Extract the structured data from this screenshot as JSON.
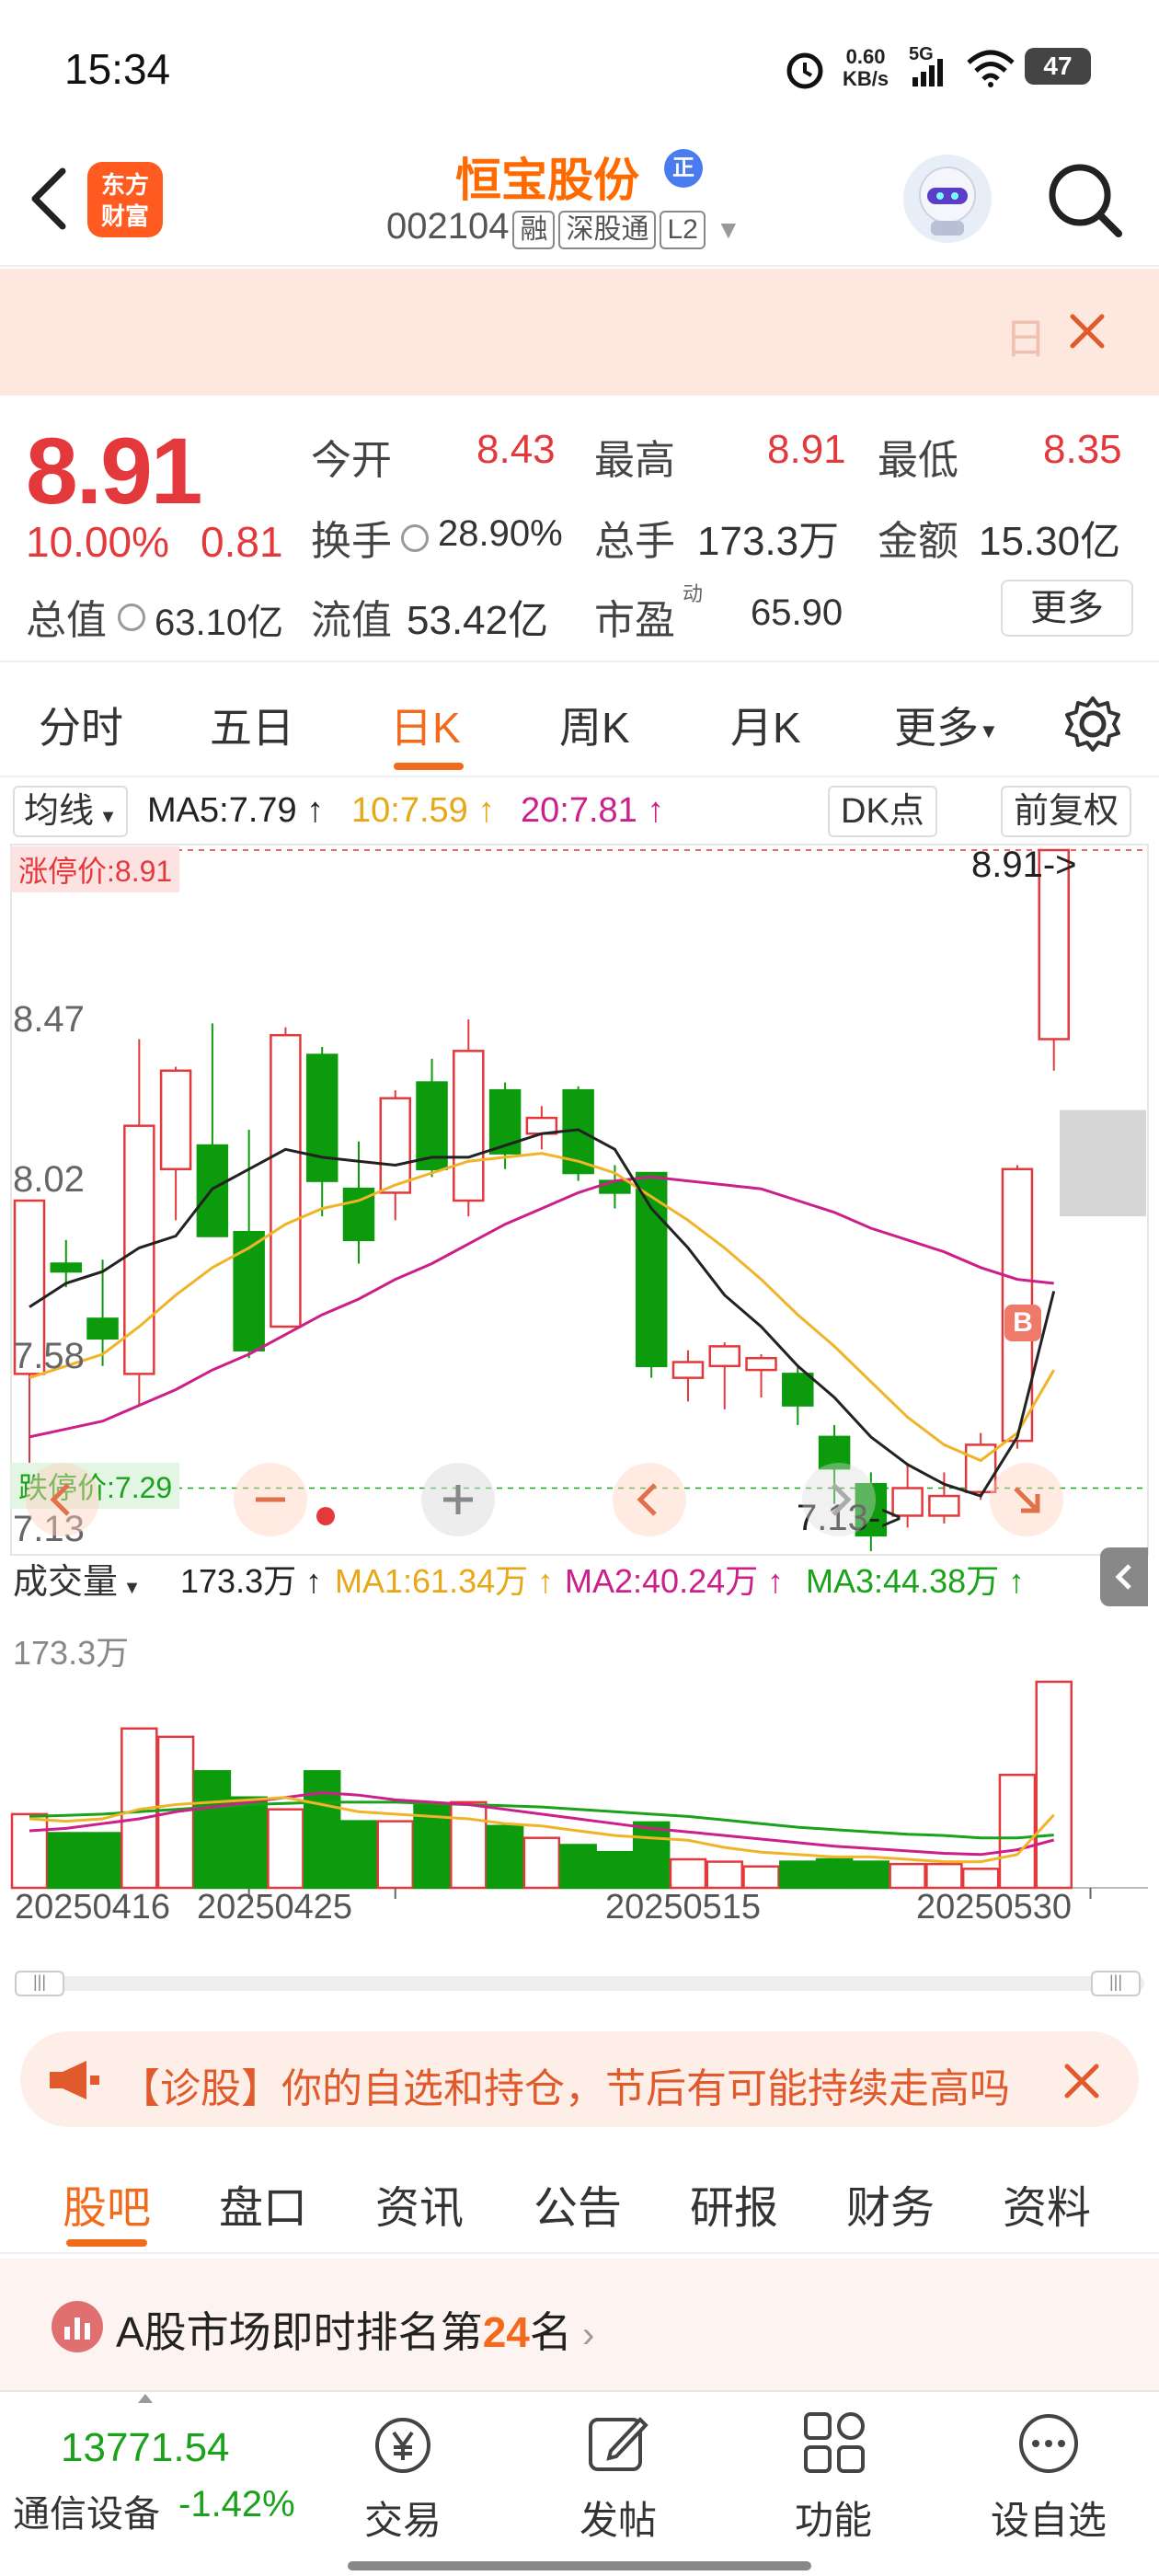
{
  "status_bar": {
    "time": "15:34",
    "net_speed_value": "0.60",
    "net_speed_unit": "KB/s",
    "signal": "5G",
    "battery": "47"
  },
  "nav": {
    "logo_line1": "东方",
    "logo_line2": "财富",
    "stock_name": "恒宝股份",
    "badge": "正",
    "stock_code": "002104",
    "tag_margin": "融",
    "tag_connect": "深股通",
    "tag_level": "L2"
  },
  "banner": {
    "text": "日"
  },
  "quote": {
    "price": "8.91",
    "change_pct": "10.00%",
    "change": "0.81",
    "open_label": "今开",
    "open": "8.43",
    "high_label": "最高",
    "high": "8.91",
    "low_label": "最低",
    "low": "8.35",
    "turnover_label": "换手",
    "turnover": "28.90%",
    "volume_label": "总手",
    "volume": "173.3万",
    "amount_label": "金额",
    "amount": "15.30亿",
    "mktcap_label": "总值",
    "mktcap": "63.10亿",
    "float_label": "流值",
    "float": "53.42亿",
    "pe_label": "市盈",
    "pe_sup": "动",
    "pe": "65.90",
    "more_button": "更多"
  },
  "period_tabs": [
    "分时",
    "五日",
    "日K",
    "周K",
    "月K",
    "更多"
  ],
  "period_tabs_active": 2,
  "chart_toolbar": {
    "indicator_select": "均线",
    "ma5": "MA5:7.79 ↑",
    "ma10": "10:7.59 ↑",
    "ma20": "20:7.81 ↑",
    "dk_button": "DK点",
    "fq_button": "前复权"
  },
  "kline_labels": {
    "limit_up": "涨停价:8.91",
    "limit_down": "跌停价:7.29",
    "y_top": "8.91",
    "y_847": "8.47",
    "y_802": "8.02",
    "y_758": "7.58",
    "y_713": "7.13",
    "max_marker": "8.91->",
    "min_marker": "7.13->",
    "buy_marker": "B"
  },
  "volume_toolbar": {
    "select": "成交量",
    "value": "173.3万 ↑",
    "ma1": "MA1:61.34万 ↑",
    "ma2": "MA2:40.24万 ↑",
    "ma3": "MA3:44.38万 ↑",
    "y_top": "173.3万"
  },
  "x_dates": [
    "20250416",
    "20250425",
    "20250515",
    "20250530"
  ],
  "chart_data": {
    "type": "candlestick",
    "dates_shown": [
      "20250416",
      "20250425",
      "20250515",
      "20250530"
    ],
    "y_ticks": [
      8.91,
      8.47,
      8.02,
      7.58,
      7.13
    ],
    "ylim": [
      7.13,
      8.91
    ],
    "candles": [
      {
        "o": 7.58,
        "c": 8.02,
        "h": 8.02,
        "l": 7.33
      },
      {
        "o": 7.86,
        "c": 7.84,
        "h": 7.92,
        "l": 7.8
      },
      {
        "o": 7.72,
        "c": 7.67,
        "h": 7.87,
        "l": 7.6
      },
      {
        "o": 7.58,
        "c": 8.21,
        "h": 8.43,
        "l": 7.5
      },
      {
        "o": 8.1,
        "c": 8.35,
        "h": 8.36,
        "l": 7.97
      },
      {
        "o": 8.16,
        "c": 7.93,
        "h": 8.47,
        "l": 7.93
      },
      {
        "o": 7.94,
        "c": 7.64,
        "h": 8.2,
        "l": 7.62
      },
      {
        "o": 7.7,
        "c": 8.44,
        "h": 8.46,
        "l": 7.7
      },
      {
        "o": 8.39,
        "c": 8.07,
        "h": 8.41,
        "l": 7.98
      },
      {
        "o": 8.05,
        "c": 7.92,
        "h": 8.17,
        "l": 7.86
      },
      {
        "o": 8.04,
        "c": 8.28,
        "h": 8.3,
        "l": 7.97
      },
      {
        "o": 8.32,
        "c": 8.1,
        "h": 8.38,
        "l": 8.08
      },
      {
        "o": 8.02,
        "c": 8.4,
        "h": 8.48,
        "l": 7.98
      },
      {
        "o": 8.3,
        "c": 8.14,
        "h": 8.32,
        "l": 8.1
      },
      {
        "o": 8.19,
        "c": 8.23,
        "h": 8.26,
        "l": 8.15
      },
      {
        "o": 8.3,
        "c": 8.09,
        "h": 8.31,
        "l": 8.07
      },
      {
        "o": 8.07,
        "c": 8.04,
        "h": 8.11,
        "l": 8.0
      },
      {
        "o": 8.09,
        "c": 7.6,
        "h": 8.09,
        "l": 7.57
      },
      {
        "o": 7.57,
        "c": 7.61,
        "h": 7.64,
        "l": 7.51
      },
      {
        "o": 7.6,
        "c": 7.65,
        "h": 7.66,
        "l": 7.49
      },
      {
        "o": 7.59,
        "c": 7.62,
        "h": 7.63,
        "l": 7.52
      },
      {
        "o": 7.58,
        "c": 7.5,
        "h": 7.6,
        "l": 7.45
      },
      {
        "o": 7.42,
        "c": 7.34,
        "h": 7.45,
        "l": 7.25
      },
      {
        "o": 7.3,
        "c": 7.17,
        "h": 7.33,
        "l": 7.13
      },
      {
        "o": 7.22,
        "c": 7.29,
        "h": 7.35,
        "l": 7.19
      },
      {
        "o": 7.22,
        "c": 7.27,
        "h": 7.33,
        "l": 7.2
      },
      {
        "o": 7.28,
        "c": 7.4,
        "h": 7.43,
        "l": 7.26
      },
      {
        "o": 7.41,
        "c": 8.1,
        "h": 8.11,
        "l": 7.39
      },
      {
        "o": 8.43,
        "c": 8.91,
        "h": 8.91,
        "l": 8.35
      }
    ],
    "ma5": [
      7.75,
      7.81,
      7.84,
      7.9,
      7.93,
      8.05,
      8.1,
      8.15,
      8.13,
      8.12,
      8.11,
      8.13,
      8.13,
      8.16,
      8.19,
      8.2,
      8.15,
      8.0,
      7.9,
      7.78,
      7.7,
      7.6,
      7.52,
      7.42,
      7.35,
      7.3,
      7.27,
      7.42,
      7.79
    ],
    "ma10": [
      7.57,
      7.6,
      7.63,
      7.7,
      7.78,
      7.85,
      7.9,
      7.96,
      8.0,
      8.02,
      8.06,
      8.09,
      8.12,
      8.13,
      8.14,
      8.12,
      8.09,
      8.03,
      7.97,
      7.9,
      7.82,
      7.73,
      7.65,
      7.56,
      7.47,
      7.4,
      7.36,
      7.43,
      7.59
    ],
    "ma20": [
      7.42,
      7.44,
      7.46,
      7.5,
      7.54,
      7.59,
      7.63,
      7.68,
      7.73,
      7.77,
      7.82,
      7.86,
      7.91,
      7.96,
      8.0,
      8.04,
      8.07,
      8.08,
      8.07,
      8.06,
      8.05,
      8.02,
      7.99,
      7.95,
      7.92,
      7.89,
      7.85,
      7.82,
      7.81
    ],
    "volume_max": 173.3,
    "volume_unit": "万",
    "volume": [
      62,
      46,
      46,
      134,
      127,
      98,
      76,
      66,
      98,
      56,
      56,
      70,
      72,
      52,
      42,
      36,
      30,
      55,
      24,
      22,
      18,
      22,
      24,
      22,
      20,
      20,
      16,
      95,
      173.3
    ],
    "vol_ma1": [
      58,
      56,
      58,
      66,
      70,
      72,
      74,
      76,
      70,
      64,
      62,
      60,
      58,
      54,
      52,
      48,
      44,
      42,
      40,
      34,
      30,
      28,
      26,
      26,
      24,
      22,
      22,
      28,
      61.34
    ],
    "vol_ma2": [
      48,
      50,
      54,
      58,
      64,
      68,
      72,
      76,
      80,
      78,
      74,
      72,
      70,
      66,
      62,
      58,
      54,
      50,
      47,
      44,
      41,
      38,
      35,
      33,
      31,
      29,
      28,
      32,
      40.24
    ],
    "vol_ma3": [
      60,
      61,
      62,
      64,
      66,
      68,
      70,
      71,
      72,
      72,
      72,
      71,
      70,
      69,
      68,
      66,
      64,
      62,
      60,
      57,
      54,
      51,
      49,
      47,
      45,
      44,
      42,
      42,
      44.38
    ],
    "colors": {
      "up": "#e4393c",
      "down": "#0c9b0c",
      "ma5": "#222222",
      "ma10": "#f0b429",
      "ma20": "#cc1f8a"
    }
  },
  "notice": {
    "text": "【诊股】你的自选和持仓，节后有可能持续走高吗"
  },
  "bottom_tabs": [
    "股吧",
    "盘口",
    "资讯",
    "公告",
    "研报",
    "财务",
    "资料"
  ],
  "bottom_tabs_active": 0,
  "rank": {
    "prefix": "A股市场即时排名第",
    "number": "24",
    "suffix": "名"
  },
  "bottom_nav": {
    "index_value": "13771.54",
    "index_name": "通信设备",
    "index_change": "-1.42%",
    "items": [
      "交易",
      "发帖",
      "功能",
      "设自选"
    ]
  }
}
